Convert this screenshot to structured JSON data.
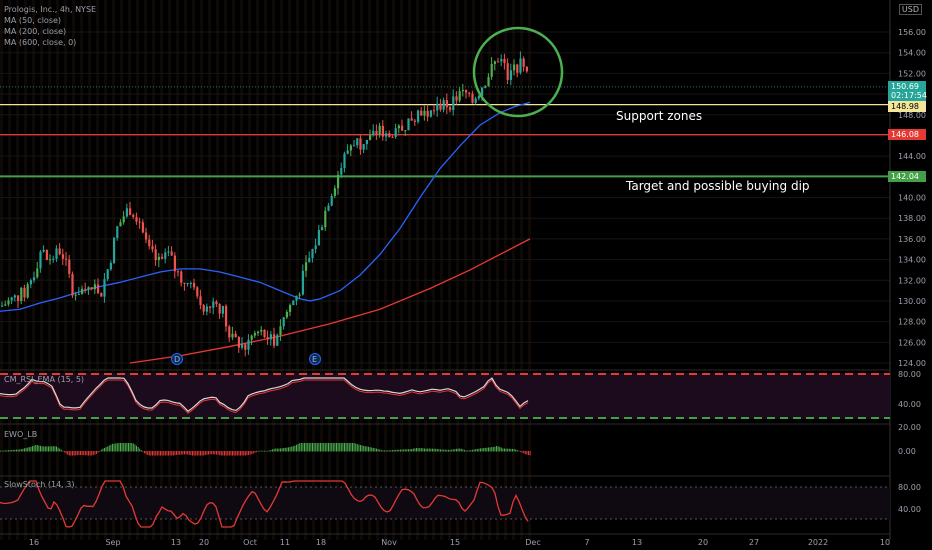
{
  "legend": {
    "title": "Prologis, Inc., 4h, NYSE",
    "ma1": "MA (50, close)",
    "ma2": "MA (200, close)",
    "ma3": "MA (600, close, 0)"
  },
  "currency": "USD",
  "annotations": {
    "support": "Support zones",
    "target": "Target and possible buying dip"
  },
  "price_tags": {
    "last": "150.69",
    "countdown": "02:17:54",
    "yellow": "148.98",
    "red": "146.08",
    "green": "142.04"
  },
  "sub_labels": {
    "rsi": "CM_RSI_EMA (15, 5)",
    "ewo": "EWO_LB",
    "stoch": "SlowStoch (14, 3)"
  },
  "colors": {
    "up": "#26a69a",
    "upBright": "#4caf50",
    "down": "#ef5350",
    "ma50": "#2962ff",
    "ma200": "#e53935",
    "hline_yellow": "#f3e59a",
    "hline_red": "#e53935",
    "hline_green": "#43a047",
    "circle": "#4caf50"
  },
  "chart_data": [
    {
      "type": "candlestick",
      "title": "Prologis, Inc., 4h, NYSE",
      "ylim": [
        123,
        158
      ],
      "y_ticks": [
        "156.00",
        "154.00",
        "152.00",
        "150.00",
        "148.00",
        "146.00",
        "144.00",
        "142.00",
        "140.00",
        "138.00",
        "136.00",
        "134.00",
        "132.00",
        "130.00",
        "128.00",
        "126.00",
        "124.00"
      ],
      "x_ticks": [
        "16",
        "Sep",
        "13",
        "20",
        "Oct",
        "11",
        "18",
        "Nov",
        "15",
        "Dec",
        "7",
        "13",
        "20",
        "27",
        "2022",
        "10"
      ],
      "close_path": [
        [
          0,
          129.5
        ],
        [
          12,
          130.2
        ],
        [
          24,
          130.8
        ],
        [
          34,
          133
        ],
        [
          40,
          135
        ],
        [
          46,
          134
        ],
        [
          52,
          134.3
        ],
        [
          60,
          135
        ],
        [
          66,
          133
        ],
        [
          72,
          131
        ],
        [
          80,
          131
        ],
        [
          90,
          131.5
        ],
        [
          100,
          131
        ],
        [
          108,
          133.5
        ],
        [
          116,
          137
        ],
        [
          124,
          138.5
        ],
        [
          130,
          139
        ],
        [
          138,
          138
        ],
        [
          146,
          135
        ],
        [
          154,
          134
        ],
        [
          160,
          133.5
        ],
        [
          168,
          134.5
        ],
        [
          174,
          133
        ],
        [
          182,
          132
        ],
        [
          190,
          131.5
        ],
        [
          196,
          130
        ],
        [
          202,
          129.5
        ],
        [
          208,
          130
        ],
        [
          214,
          130
        ],
        [
          222,
          129
        ],
        [
          228,
          126.5
        ],
        [
          236,
          126
        ],
        [
          244,
          125.5
        ],
        [
          250,
          126.5
        ],
        [
          258,
          127
        ],
        [
          266,
          126.5
        ],
        [
          272,
          126
        ],
        [
          278,
          127.5
        ],
        [
          286,
          129
        ],
        [
          292,
          130
        ],
        [
          298,
          131
        ],
        [
          304,
          133
        ],
        [
          310,
          134.5
        ],
        [
          316,
          136
        ],
        [
          322,
          138
        ],
        [
          328,
          140
        ],
        [
          334,
          141.5
        ],
        [
          340,
          143
        ],
        [
          346,
          144.5
        ],
        [
          352,
          145.5
        ],
        [
          358,
          145.3
        ],
        [
          366,
          145.5
        ],
        [
          372,
          146
        ],
        [
          380,
          146.5
        ],
        [
          386,
          146
        ],
        [
          392,
          145.8
        ],
        [
          400,
          146.5
        ],
        [
          408,
          147.5
        ],
        [
          414,
          148
        ],
        [
          420,
          148.5
        ],
        [
          428,
          148
        ],
        [
          434,
          148.5
        ],
        [
          440,
          149
        ],
        [
          446,
          149
        ],
        [
          452,
          149.3
        ],
        [
          458,
          149.8
        ],
        [
          464,
          150.2
        ],
        [
          470,
          149
        ],
        [
          476,
          150
        ],
        [
          482,
          151
        ],
        [
          488,
          152
        ],
        [
          494,
          153
        ],
        [
          500,
          154
        ],
        [
          506,
          151.5
        ],
        [
          512,
          152.2
        ],
        [
          518,
          153
        ],
        [
          524,
          152
        ],
        [
          530,
          150.7
        ]
      ],
      "ma50_path": [
        [
          0,
          129
        ],
        [
          20,
          129.2
        ],
        [
          40,
          129.8
        ],
        [
          60,
          130.3
        ],
        [
          80,
          130.9
        ],
        [
          100,
          131.4
        ],
        [
          120,
          131.8
        ],
        [
          140,
          132.3
        ],
        [
          160,
          132.8
        ],
        [
          180,
          133.1
        ],
        [
          200,
          133.1
        ],
        [
          220,
          132.8
        ],
        [
          240,
          132.3
        ],
        [
          260,
          131.8
        ],
        [
          280,
          131
        ],
        [
          300,
          130.2
        ],
        [
          310,
          130
        ],
        [
          320,
          130.2
        ],
        [
          340,
          131
        ],
        [
          360,
          132.5
        ],
        [
          380,
          134.5
        ],
        [
          400,
          137
        ],
        [
          420,
          140
        ],
        [
          440,
          142.8
        ],
        [
          460,
          145
        ],
        [
          480,
          147
        ],
        [
          500,
          148.2
        ],
        [
          515,
          148.8
        ],
        [
          530,
          149.2
        ]
      ],
      "ma200_path": [
        [
          130,
          124
        ],
        [
          180,
          124.7
        ],
        [
          230,
          125.6
        ],
        [
          280,
          126.6
        ],
        [
          330,
          127.8
        ],
        [
          380,
          129.2
        ],
        [
          430,
          131.2
        ],
        [
          470,
          133
        ],
        [
          500,
          134.5
        ],
        [
          530,
          136
        ]
      ],
      "hlines": [
        148.98,
        146.08,
        142.04
      ],
      "last_price": 150.69
    },
    {
      "type": "line",
      "name": "CM_RSI_EMA (15, 5)",
      "ylim": [
        0,
        100
      ],
      "y_ticks": [
        "80.00",
        "40.00"
      ],
      "bands": [
        80,
        20
      ]
    },
    {
      "type": "bar",
      "name": "EWO_LB",
      "y_ticks": [
        "20.00",
        "0.00"
      ]
    },
    {
      "type": "line",
      "name": "SlowStoch (14, 3)",
      "ylim": [
        0,
        100
      ],
      "y_ticks": [
        "80.00",
        "40.00"
      ],
      "bands": [
        80,
        20
      ]
    }
  ]
}
